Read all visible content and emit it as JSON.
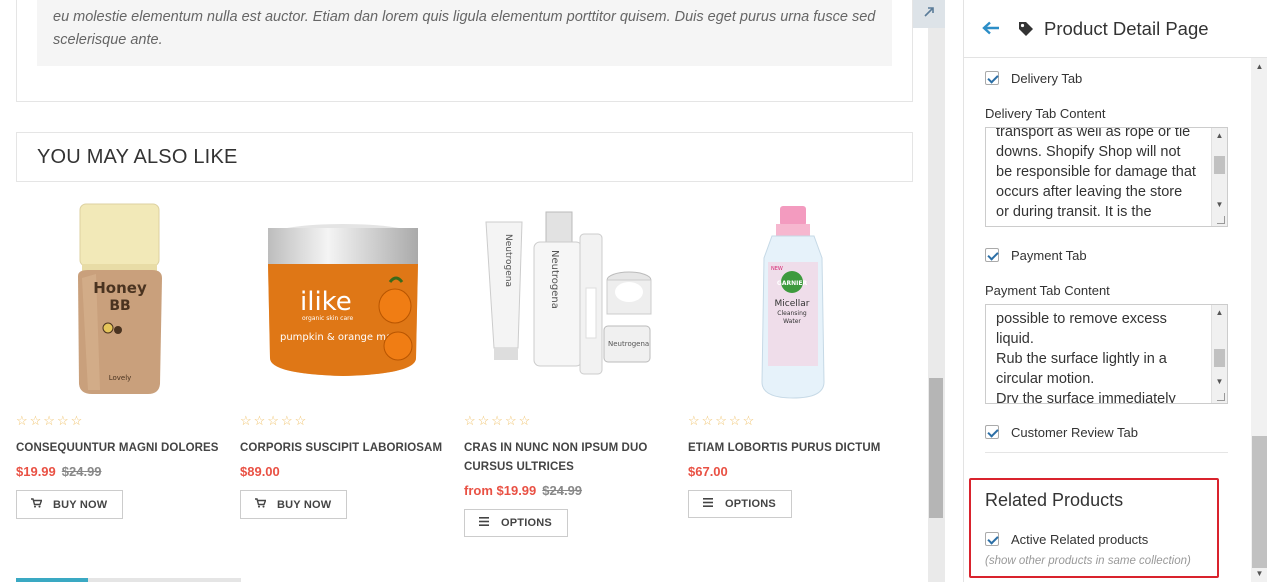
{
  "description": {
    "text": "eu molestie elementum nulla est auctor. Etiam dan lorem quis ligula elementum porttitor quisem. Duis eget purus urna fusce sed scelerisque ante."
  },
  "section_title": "YOU MAY ALSO LIKE",
  "products": [
    {
      "title": "CONSEQUUNTUR MAGNI DOLORES",
      "price": "$19.99",
      "compare_price": "$24.99",
      "button": "BUY NOW",
      "button_icon": "cart-icon",
      "rating": "☆☆☆☆☆"
    },
    {
      "title": "CORPORIS SUSCIPIT LABORIOSAM",
      "price": "$89.00",
      "compare_price": "",
      "button": "BUY NOW",
      "button_icon": "cart-icon",
      "rating": "☆☆☆☆☆"
    },
    {
      "title": "CRAS IN NUNC NON IPSUM DUO CURSUS ULTRICES",
      "price": "from $19.99",
      "compare_price": "$24.99",
      "button": "OPTIONS",
      "button_icon": "menu-icon",
      "rating": "☆☆☆☆☆"
    },
    {
      "title": "ETIAM LOBORTIS PURUS DICTUM",
      "price": "$67.00",
      "compare_price": "",
      "button": "OPTIONS",
      "button_icon": "menu-icon",
      "rating": "☆☆☆☆☆"
    }
  ],
  "product_images": {
    "p1_label_1": "Honey",
    "p1_label_2": "BB",
    "p1_label_3": "Lovely",
    "p2_brand": "ilike",
    "p2_sub": "organic skin care",
    "p2_product": "pumpkin & orange mask",
    "p3_brand": "Neutrogena",
    "p4_brand": "GARNIER",
    "p4_product_1": "Micellar",
    "p4_product_2": "Cleansing",
    "p4_product_3": "Water",
    "p4_badge": "NEW"
  },
  "panel": {
    "title": "Product Detail Page",
    "back_icon": "back-arrow-icon",
    "tag_icon": "tag-icon",
    "delivery_tab": {
      "label": "Delivery Tab",
      "checked": true
    },
    "delivery_content_label": "Delivery Tab Content",
    "delivery_content_lines": [
      "transport as well as rope or tie",
      "downs. Shopify Shop will not",
      "be responsible for damage that",
      "occurs after leaving the store",
      "or during transit. It is the"
    ],
    "payment_tab": {
      "label": "Payment Tab",
      "checked": true
    },
    "payment_content_label": "Payment Tab Content",
    "payment_content_lines": [
      "possible to remove excess",
      "liquid.",
      "Rub the surface lightly in a",
      "circular motion.",
      "Dry the surface immediately"
    ],
    "review_tab": {
      "label": "Customer Review Tab",
      "checked": true
    },
    "related": {
      "title": "Related Products",
      "active_label": "Active Related products",
      "checked": true,
      "hint": "(show other products in same collection)"
    }
  },
  "colors": {
    "accent": "#2c8ec7",
    "price": "#e95144",
    "highlight_border": "#d9232d",
    "stars": "#f0c36d"
  }
}
